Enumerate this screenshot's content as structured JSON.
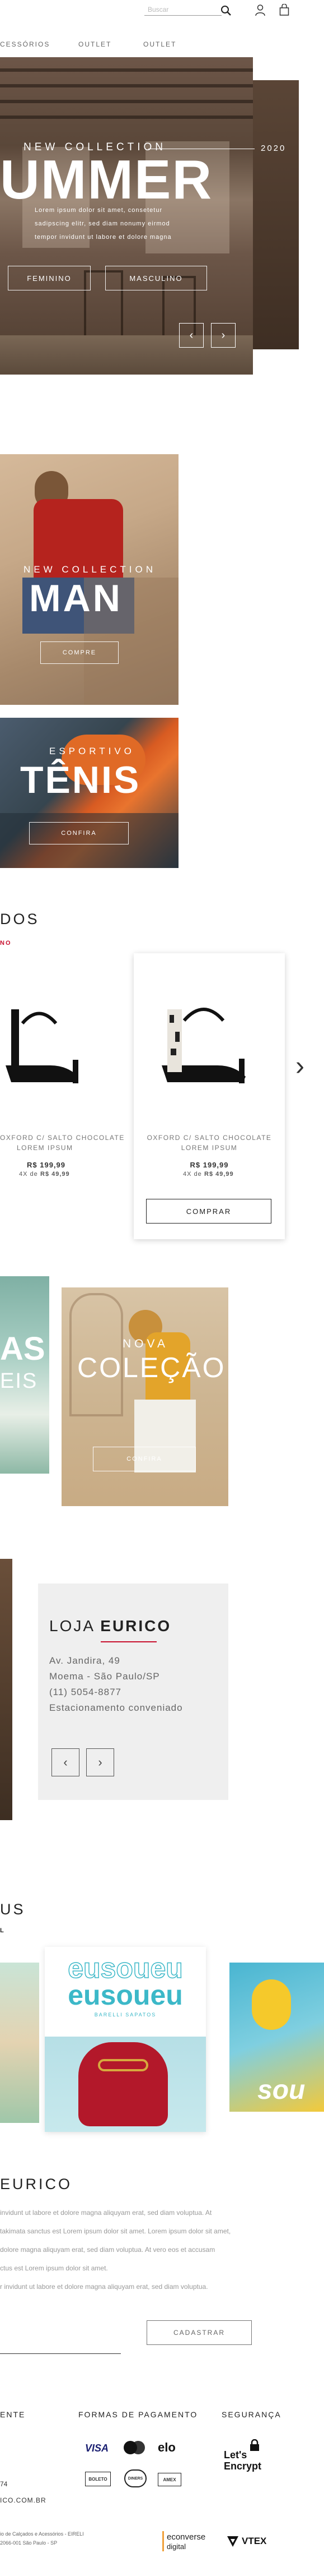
{
  "header": {
    "search_placeholder": "Buscar",
    "nav": [
      "CESSÓRIOS",
      "OUTLET",
      "OUTLET"
    ]
  },
  "hero": {
    "kicker": "NEW COLLECTION",
    "year": "2020",
    "title": "UMMER",
    "body_lines": [
      "Lorem ipsum dolor sit amet, consetetur",
      "sadipscing elitr, sed diam nonumy eirmod",
      "tempor invidunt ut labore et dolore magna"
    ],
    "btn_female": "FEMININO",
    "btn_male": "MASCULINO",
    "prev_arrow": "‹",
    "next_arrow": "›"
  },
  "promo_man": {
    "kicker": "NEW COLLECTION",
    "title": "MAN",
    "cta": "COMPRE"
  },
  "promo_tenis": {
    "kicker": "ESPORTIVO",
    "title": "TÊNIS",
    "cta": "CONFIRA"
  },
  "products": {
    "heading": "DOS",
    "subheading": "NO",
    "items": [
      {
        "name_lines": [
          "OXFORD C/ SALTO CHOCOLATE",
          "LOREM IPSUM"
        ],
        "price": "R$ 199,99",
        "installment_prefix": "4X de",
        "installment_value": "R$ 49,99"
      },
      {
        "name_lines": [
          "OXFORD C/ SALTO CHOCOLATE",
          "LOREM IPSUM"
        ],
        "price": "R$ 199,99",
        "installment_prefix": "4X de",
        "installment_value": "R$ 49,99",
        "buy_label": "COMPRAR"
      }
    ],
    "next_arrow": "›"
  },
  "collection": {
    "left_partial": [
      "AS",
      "EIS"
    ],
    "kicker": "NOVA",
    "title": "COLEÇÃO",
    "cta": "CONFIRA"
  },
  "store": {
    "title_light": "LOJA",
    "title_bold": "EURICO",
    "lines": [
      "Av. Jandira, 49",
      "Moema - São Paulo/SP",
      "(11) 5054-8877",
      "Estacionamento conveniado"
    ],
    "prev_arrow": "‹",
    "next_arrow": "›"
  },
  "social": {
    "heading": "US",
    "subheading": "L",
    "tile_text": "eusoueu",
    "tile_text_sub": "BARELLI SAPATOS",
    "tile_sou": "sou"
  },
  "newsletter": {
    "heading": "EURICO",
    "lines": [
      "invidunt ut labore et dolore magna aliquyam erat, sed diam voluptua. At",
      "takimata sanctus est Lorem ipsum dolor sit amet. Lorem ipsum dolor sit amet,",
      "dolore magna aliquyam erat, sed diam voluptua. At vero eos et accusam",
      "ctus est Lorem ipsum dolor sit amet.",
      "r invidunt ut labore et dolore magna aliquyam erat, sed diam voluptua."
    ],
    "submit_label": "CADASTRAR"
  },
  "footer": {
    "col1_heading": "ENTE",
    "col2_heading": "FORMAS DE PAGAMENTO",
    "col3_heading": "SEGURANÇA",
    "pay_row1": [
      "VISA",
      "●●",
      "elo"
    ],
    "pay_row2": [
      "BOLETO",
      "DINERS",
      "AMEX"
    ],
    "security_lines": [
      "Let's",
      "Encrypt"
    ],
    "phone_partial": "74",
    "email_partial": "ICO.COM.BR",
    "legal_lines": [
      "io de Calçados e Acessórios - EIRELI",
      "2066-001 São Paulo - SP"
    ],
    "partner1": "econverse",
    "partner1_sub": "digital",
    "partner2": "VTEX"
  }
}
